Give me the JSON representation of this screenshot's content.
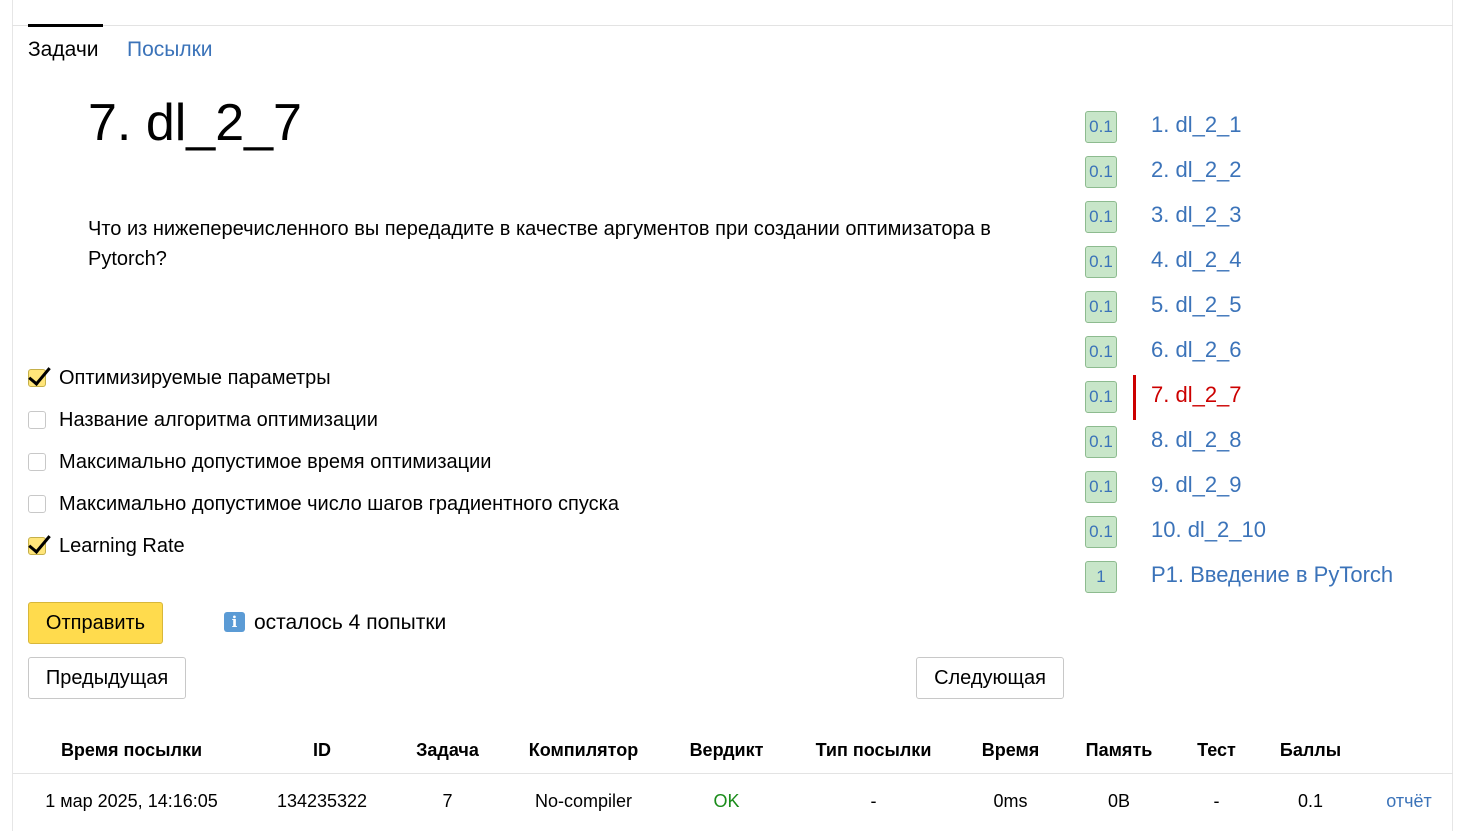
{
  "tabs": {
    "tasks": "Задачи",
    "submissions": "Посылки"
  },
  "problem": {
    "title": "7. dl_2_7",
    "question": "Что из нижеперечисленного вы передадите в качестве аргументов при создании оптимизатора в Pytorch?"
  },
  "options": [
    {
      "label": "Оптимизируемые параметры",
      "checked": true
    },
    {
      "label": "Название алгоритма оптимизации",
      "checked": false
    },
    {
      "label": "Максимально допустимое время оптимизации",
      "checked": false
    },
    {
      "label": "Максимально допустимое число шагов градиентного спуска",
      "checked": false
    },
    {
      "label": "Learning Rate",
      "checked": true
    }
  ],
  "actions": {
    "submit": "Отправить",
    "attempts_left": "осталось 4 попытки",
    "prev": "Предыдущая",
    "next": "Следующая"
  },
  "problem_list": [
    {
      "score": "0.1",
      "name": "1. dl_2_1"
    },
    {
      "score": "0.1",
      "name": "2. dl_2_2"
    },
    {
      "score": "0.1",
      "name": "3. dl_2_3"
    },
    {
      "score": "0.1",
      "name": "4. dl_2_4"
    },
    {
      "score": "0.1",
      "name": "5. dl_2_5"
    },
    {
      "score": "0.1",
      "name": "6. dl_2_6"
    },
    {
      "score": "0.1",
      "name": "7. dl_2_7",
      "active": true
    },
    {
      "score": "0.1",
      "name": "8. dl_2_8"
    },
    {
      "score": "0.1",
      "name": "9. dl_2_9"
    },
    {
      "score": "0.1",
      "name": "10. dl_2_10"
    },
    {
      "score": "1",
      "name": "P1. Введение в PyTorch"
    }
  ],
  "submissions_table": {
    "headers": [
      "Время посылки",
      "ID",
      "Задача",
      "Компилятор",
      "Вердикт",
      "Тип посылки",
      "Время",
      "Память",
      "Тест",
      "Баллы",
      ""
    ],
    "rows": [
      {
        "time": "1 мар 2025, 14:16:05",
        "id": "134235322",
        "task": "7",
        "compiler": "No-compiler",
        "verdict": "OK",
        "type": "-",
        "run_time": "0ms",
        "memory": "0B",
        "test": "-",
        "score": "0.1",
        "report": "отчёт"
      }
    ]
  },
  "colors": {
    "accent_link": "#3b73b9",
    "active": "#cc0000",
    "submit": "#ffdb4d",
    "ok": "#1a8c1a",
    "badge_bg": "#c8e6c9"
  }
}
